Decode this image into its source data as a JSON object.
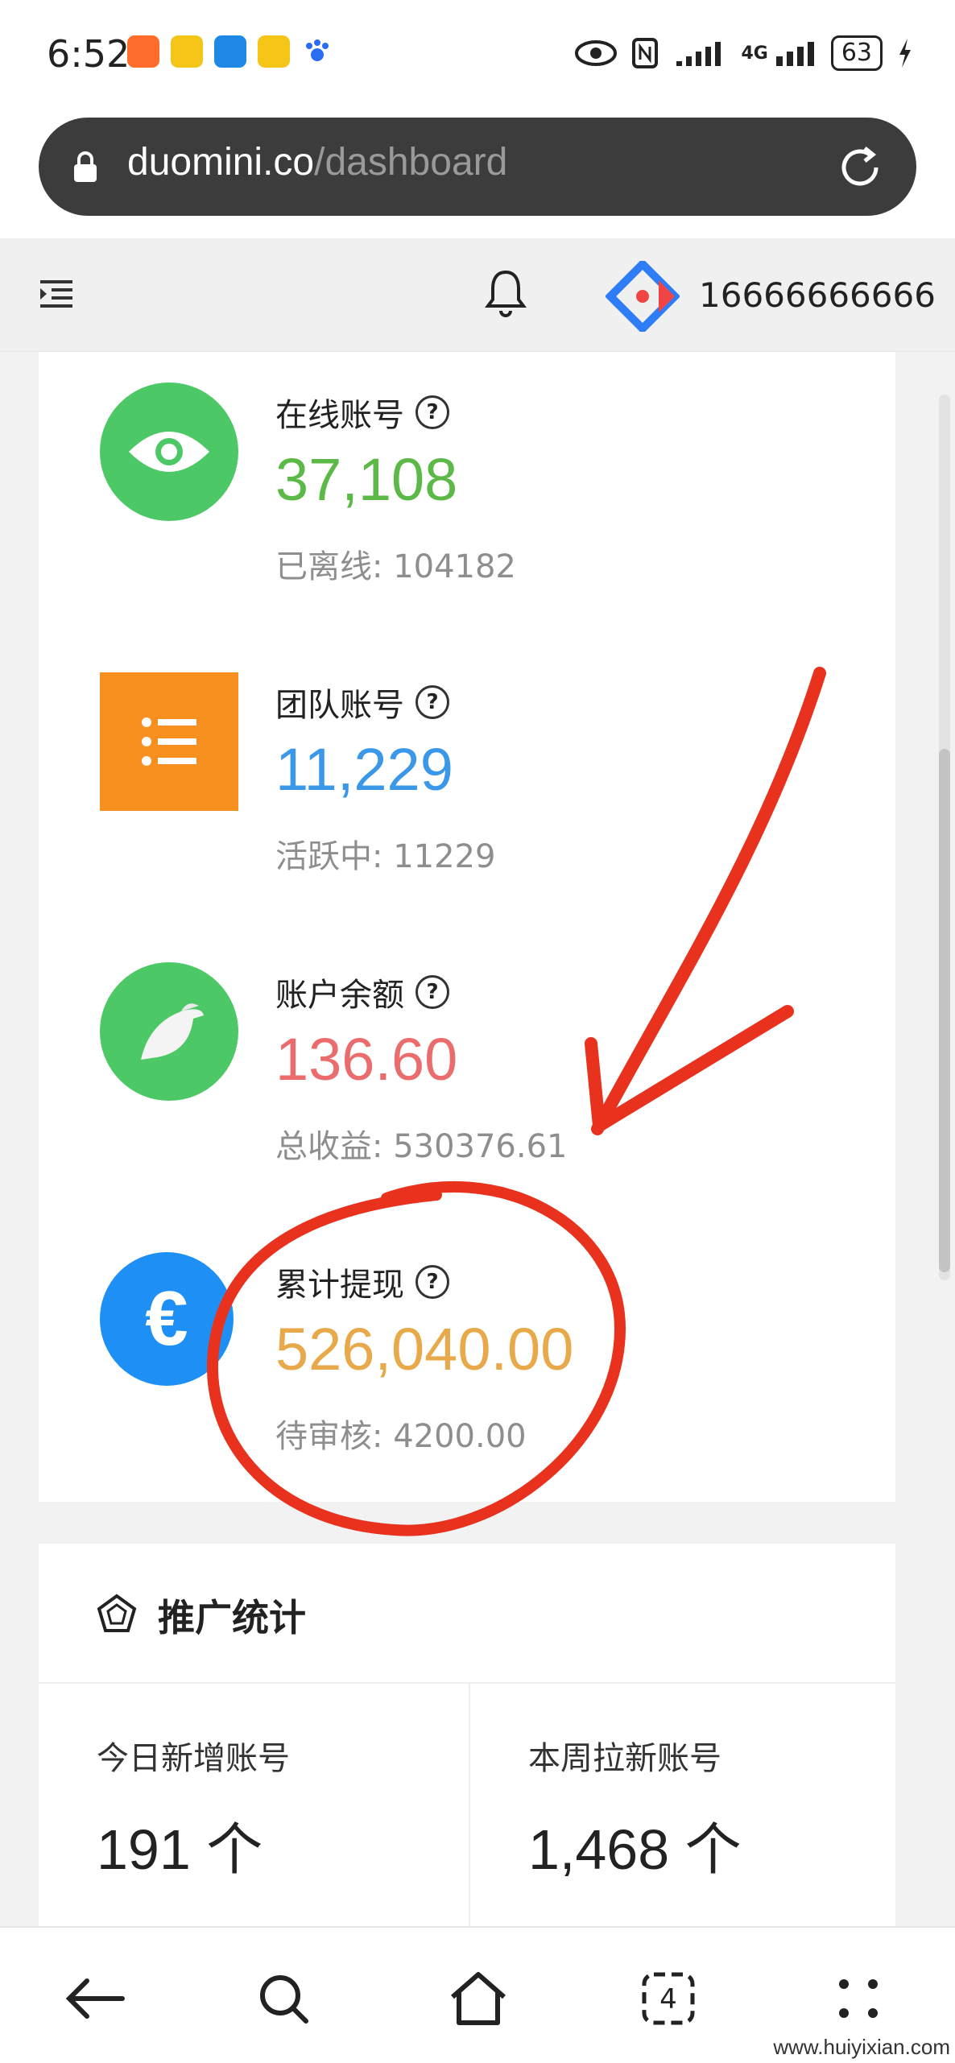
{
  "status_bar": {
    "time": "6:52",
    "battery": "63",
    "network": "4G"
  },
  "browser": {
    "url_domain": "duomini.co",
    "url_path": "/dashboard"
  },
  "header": {
    "user_phone": "16666666666"
  },
  "stats": [
    {
      "label": "在线账号",
      "value": "37,108",
      "sub": "已离线: 104182",
      "icon": "eye-icon",
      "icon_bg": "#4dc866",
      "value_color": "#5cb947"
    },
    {
      "label": "团队账号",
      "value": "11,229",
      "sub": "活跃中: 11229",
      "icon": "list-icon",
      "icon_bg": "#f7901e",
      "value_color": "#3b98e8"
    },
    {
      "label": "账户余额",
      "value": "136.60",
      "sub": "总收益: 530376.61",
      "icon": "bird-icon",
      "icon_bg": "#4dc866",
      "value_color": "#ea6c6c"
    },
    {
      "label": "累计提现",
      "value": "526,040.00",
      "sub": "待审核: 4200.00",
      "icon": "euro-icon",
      "icon_bg": "#1e90f5",
      "value_color": "#e8a94a"
    }
  ],
  "promo": {
    "title": "推广统计",
    "today_label": "今日新增账号",
    "today_value": "191 个",
    "week_label": "本周拉新账号",
    "week_value": "1,468 个"
  },
  "colors": {
    "annotation_red": "#e8321e",
    "urlbar_bg": "#3c3c3c"
  },
  "watermark": "www.huiyixian.com"
}
